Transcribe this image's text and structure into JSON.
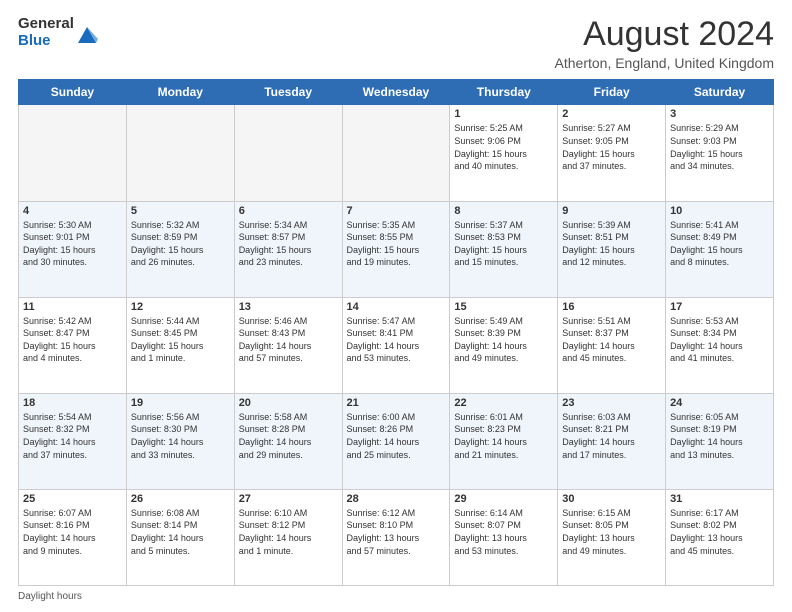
{
  "header": {
    "logo_general": "General",
    "logo_blue": "Blue",
    "title": "August 2024",
    "subtitle": "Atherton, England, United Kingdom"
  },
  "calendar": {
    "days_of_week": [
      "Sunday",
      "Monday",
      "Tuesday",
      "Wednesday",
      "Thursday",
      "Friday",
      "Saturday"
    ],
    "weeks": [
      [
        {
          "day": "",
          "info": ""
        },
        {
          "day": "",
          "info": ""
        },
        {
          "day": "",
          "info": ""
        },
        {
          "day": "",
          "info": ""
        },
        {
          "day": "1",
          "info": "Sunrise: 5:25 AM\nSunset: 9:06 PM\nDaylight: 15 hours\nand 40 minutes."
        },
        {
          "day": "2",
          "info": "Sunrise: 5:27 AM\nSunset: 9:05 PM\nDaylight: 15 hours\nand 37 minutes."
        },
        {
          "day": "3",
          "info": "Sunrise: 5:29 AM\nSunset: 9:03 PM\nDaylight: 15 hours\nand 34 minutes."
        }
      ],
      [
        {
          "day": "4",
          "info": "Sunrise: 5:30 AM\nSunset: 9:01 PM\nDaylight: 15 hours\nand 30 minutes."
        },
        {
          "day": "5",
          "info": "Sunrise: 5:32 AM\nSunset: 8:59 PM\nDaylight: 15 hours\nand 26 minutes."
        },
        {
          "day": "6",
          "info": "Sunrise: 5:34 AM\nSunset: 8:57 PM\nDaylight: 15 hours\nand 23 minutes."
        },
        {
          "day": "7",
          "info": "Sunrise: 5:35 AM\nSunset: 8:55 PM\nDaylight: 15 hours\nand 19 minutes."
        },
        {
          "day": "8",
          "info": "Sunrise: 5:37 AM\nSunset: 8:53 PM\nDaylight: 15 hours\nand 15 minutes."
        },
        {
          "day": "9",
          "info": "Sunrise: 5:39 AM\nSunset: 8:51 PM\nDaylight: 15 hours\nand 12 minutes."
        },
        {
          "day": "10",
          "info": "Sunrise: 5:41 AM\nSunset: 8:49 PM\nDaylight: 15 hours\nand 8 minutes."
        }
      ],
      [
        {
          "day": "11",
          "info": "Sunrise: 5:42 AM\nSunset: 8:47 PM\nDaylight: 15 hours\nand 4 minutes."
        },
        {
          "day": "12",
          "info": "Sunrise: 5:44 AM\nSunset: 8:45 PM\nDaylight: 15 hours\nand 1 minute."
        },
        {
          "day": "13",
          "info": "Sunrise: 5:46 AM\nSunset: 8:43 PM\nDaylight: 14 hours\nand 57 minutes."
        },
        {
          "day": "14",
          "info": "Sunrise: 5:47 AM\nSunset: 8:41 PM\nDaylight: 14 hours\nand 53 minutes."
        },
        {
          "day": "15",
          "info": "Sunrise: 5:49 AM\nSunset: 8:39 PM\nDaylight: 14 hours\nand 49 minutes."
        },
        {
          "day": "16",
          "info": "Sunrise: 5:51 AM\nSunset: 8:37 PM\nDaylight: 14 hours\nand 45 minutes."
        },
        {
          "day": "17",
          "info": "Sunrise: 5:53 AM\nSunset: 8:34 PM\nDaylight: 14 hours\nand 41 minutes."
        }
      ],
      [
        {
          "day": "18",
          "info": "Sunrise: 5:54 AM\nSunset: 8:32 PM\nDaylight: 14 hours\nand 37 minutes."
        },
        {
          "day": "19",
          "info": "Sunrise: 5:56 AM\nSunset: 8:30 PM\nDaylight: 14 hours\nand 33 minutes."
        },
        {
          "day": "20",
          "info": "Sunrise: 5:58 AM\nSunset: 8:28 PM\nDaylight: 14 hours\nand 29 minutes."
        },
        {
          "day": "21",
          "info": "Sunrise: 6:00 AM\nSunset: 8:26 PM\nDaylight: 14 hours\nand 25 minutes."
        },
        {
          "day": "22",
          "info": "Sunrise: 6:01 AM\nSunset: 8:23 PM\nDaylight: 14 hours\nand 21 minutes."
        },
        {
          "day": "23",
          "info": "Sunrise: 6:03 AM\nSunset: 8:21 PM\nDaylight: 14 hours\nand 17 minutes."
        },
        {
          "day": "24",
          "info": "Sunrise: 6:05 AM\nSunset: 8:19 PM\nDaylight: 14 hours\nand 13 minutes."
        }
      ],
      [
        {
          "day": "25",
          "info": "Sunrise: 6:07 AM\nSunset: 8:16 PM\nDaylight: 14 hours\nand 9 minutes."
        },
        {
          "day": "26",
          "info": "Sunrise: 6:08 AM\nSunset: 8:14 PM\nDaylight: 14 hours\nand 5 minutes."
        },
        {
          "day": "27",
          "info": "Sunrise: 6:10 AM\nSunset: 8:12 PM\nDaylight: 14 hours\nand 1 minute."
        },
        {
          "day": "28",
          "info": "Sunrise: 6:12 AM\nSunset: 8:10 PM\nDaylight: 13 hours\nand 57 minutes."
        },
        {
          "day": "29",
          "info": "Sunrise: 6:14 AM\nSunset: 8:07 PM\nDaylight: 13 hours\nand 53 minutes."
        },
        {
          "day": "30",
          "info": "Sunrise: 6:15 AM\nSunset: 8:05 PM\nDaylight: 13 hours\nand 49 minutes."
        },
        {
          "day": "31",
          "info": "Sunrise: 6:17 AM\nSunset: 8:02 PM\nDaylight: 13 hours\nand 45 minutes."
        }
      ]
    ]
  },
  "footer": {
    "label": "Daylight hours"
  }
}
